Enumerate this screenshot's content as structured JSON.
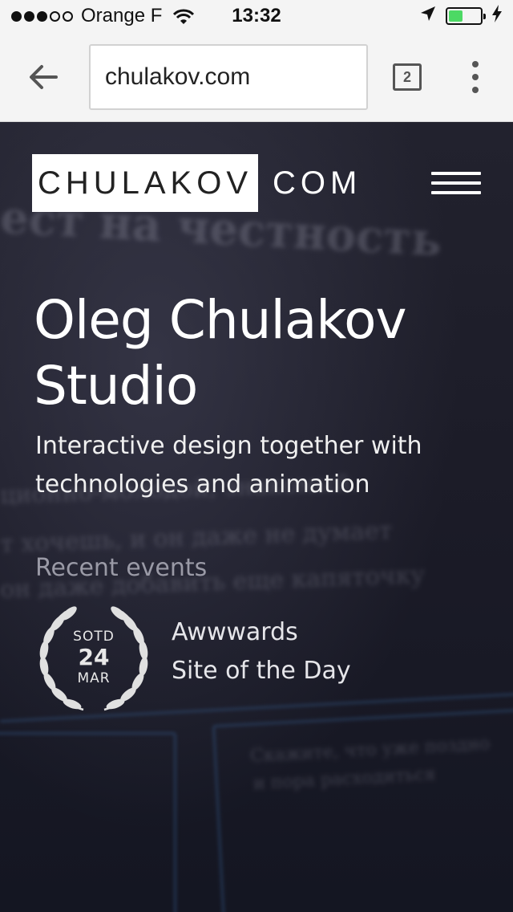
{
  "status_bar": {
    "carrier": "Orange F",
    "time": "13:32",
    "battery_level": 0.45
  },
  "browser": {
    "url": "chulakov.com",
    "tab_count": "2"
  },
  "site": {
    "logo_name": "CHULAKOV",
    "logo_tld": "COM",
    "title_line1": "Oleg Chulakov",
    "title_line2": "Studio",
    "subtitle_line1": "Interactive design together with",
    "subtitle_line2": "technologies and animation",
    "recent_events_label": "Recent events",
    "badge": {
      "label": "SOTD",
      "day": "24",
      "month": "MAR"
    },
    "award_line1": "Awwwards",
    "award_line2": "Site of the Day"
  },
  "background_text": {
    "line1": "ест на честность",
    "line2": "ционно-молодой, знакомый.",
    "line3": "т хочешь, и он даже не думает",
    "line4": "он даже добавить еще капяточку",
    "line5": "Скажите, что уже поздно",
    "line6": "и пора расходиться"
  },
  "colors": {
    "accent_battery": "#4cd964",
    "hero_bg": "#1b1b27",
    "toolbar_bg": "#f4f4f4"
  }
}
